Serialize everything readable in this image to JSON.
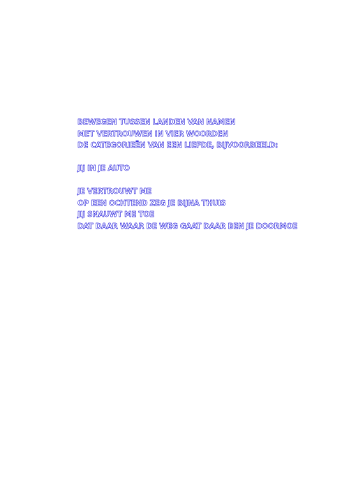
{
  "poem": {
    "stanzas": [
      {
        "lines": [
          "BEWEGEN TUSSEN LANDEN VAN NAMEN",
          "MET VERTROUWEN IN VIER WOORDEN",
          "DE CATEGORIEËN VAN EEN LIEFDE, BIJVOORBEELD:"
        ]
      },
      {
        "lines": [
          "JIJ IN JE AUTO"
        ]
      },
      {
        "lines": [
          "JE VERTROUWT ME",
          "OP EEN OCHTEND ZEG JE BIJNA THUIS",
          "JIJ SNAUWT ME TOE",
          "DAT DAAR WAAR DE WEG GAAT DAAR BEN JE DOORMOE"
        ]
      }
    ],
    "text_color": "#3b35e0",
    "background": "#ffffff"
  }
}
